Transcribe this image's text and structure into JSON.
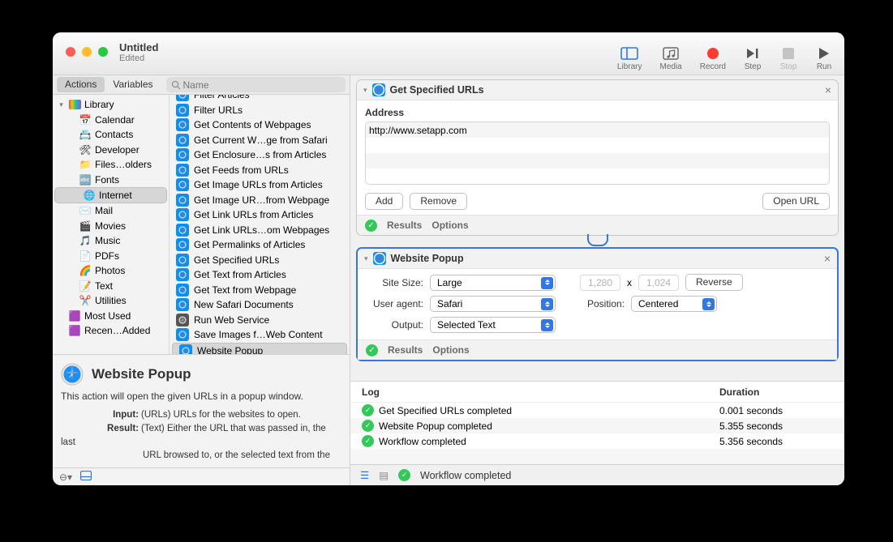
{
  "window": {
    "title": "Untitled",
    "subtitle": "Edited"
  },
  "toolbar": {
    "library": "Library",
    "media": "Media",
    "record": "Record",
    "step": "Step",
    "stop": "Stop",
    "run": "Run"
  },
  "subtoolbar": {
    "actions": "Actions",
    "variables": "Variables",
    "search_placeholder": "Name"
  },
  "tree": {
    "root": "Library",
    "items": [
      "Calendar",
      "Contacts",
      "Developer",
      "Files…olders",
      "Fonts",
      "Internet",
      "Mail",
      "Movies",
      "Music",
      "PDFs",
      "Photos",
      "Text",
      "Utilities"
    ],
    "below": [
      "Most Used",
      "Recen…Added"
    ]
  },
  "actions_list": [
    "Filter Articles",
    "Filter URLs",
    "Get Contents of Webpages",
    "Get Current W…ge from Safari",
    "Get Enclosure…s from Articles",
    "Get Feeds from URLs",
    "Get Image URLs from Articles",
    "Get Image UR…from Webpage",
    "Get Link URLs from Articles",
    "Get Link URLs…om Webpages",
    "Get Permalinks of Articles",
    "Get Specified URLs",
    "Get Text from Articles",
    "Get Text from Webpage",
    "New Safari Documents",
    "Run Web Service",
    "Save Images f…Web Content",
    "Website Popup"
  ],
  "info": {
    "title": "Website Popup",
    "desc": "This action will open the given URLs in a popup window.",
    "input_label": "Input:",
    "input_text": "(URLs) URLs for the websites to open.",
    "result_label": "Result:",
    "result_text1": "(Text) Either the URL that was passed in, the last",
    "result_text2": "URL browsed to, or the selected text from the"
  },
  "card1": {
    "title": "Get Specified URLs",
    "table_header": "Address",
    "rows": [
      "http://www.setapp.com"
    ],
    "add": "Add",
    "remove": "Remove",
    "openurl": "Open URL",
    "results": "Results",
    "options": "Options"
  },
  "card2": {
    "title": "Website Popup",
    "site_size_l": "Site Size:",
    "site_size_v": "Large",
    "user_agent_l": "User agent:",
    "user_agent_v": "Safari",
    "output_l": "Output:",
    "output_v": "Selected Text",
    "w": "1,280",
    "times": "x",
    "h": "1,024",
    "reverse": "Reverse",
    "position_l": "Position:",
    "position_v": "Centered",
    "results": "Results",
    "options": "Options"
  },
  "log": {
    "h1": "Log",
    "h2": "Duration",
    "rows": [
      {
        "msg": "Get Specified URLs completed",
        "dur": "0.001 seconds"
      },
      {
        "msg": "Website Popup completed",
        "dur": "5.355 seconds"
      },
      {
        "msg": "Workflow completed",
        "dur": "5.356 seconds"
      }
    ]
  },
  "status": {
    "msg": "Workflow completed",
    "gear": "⚙"
  }
}
